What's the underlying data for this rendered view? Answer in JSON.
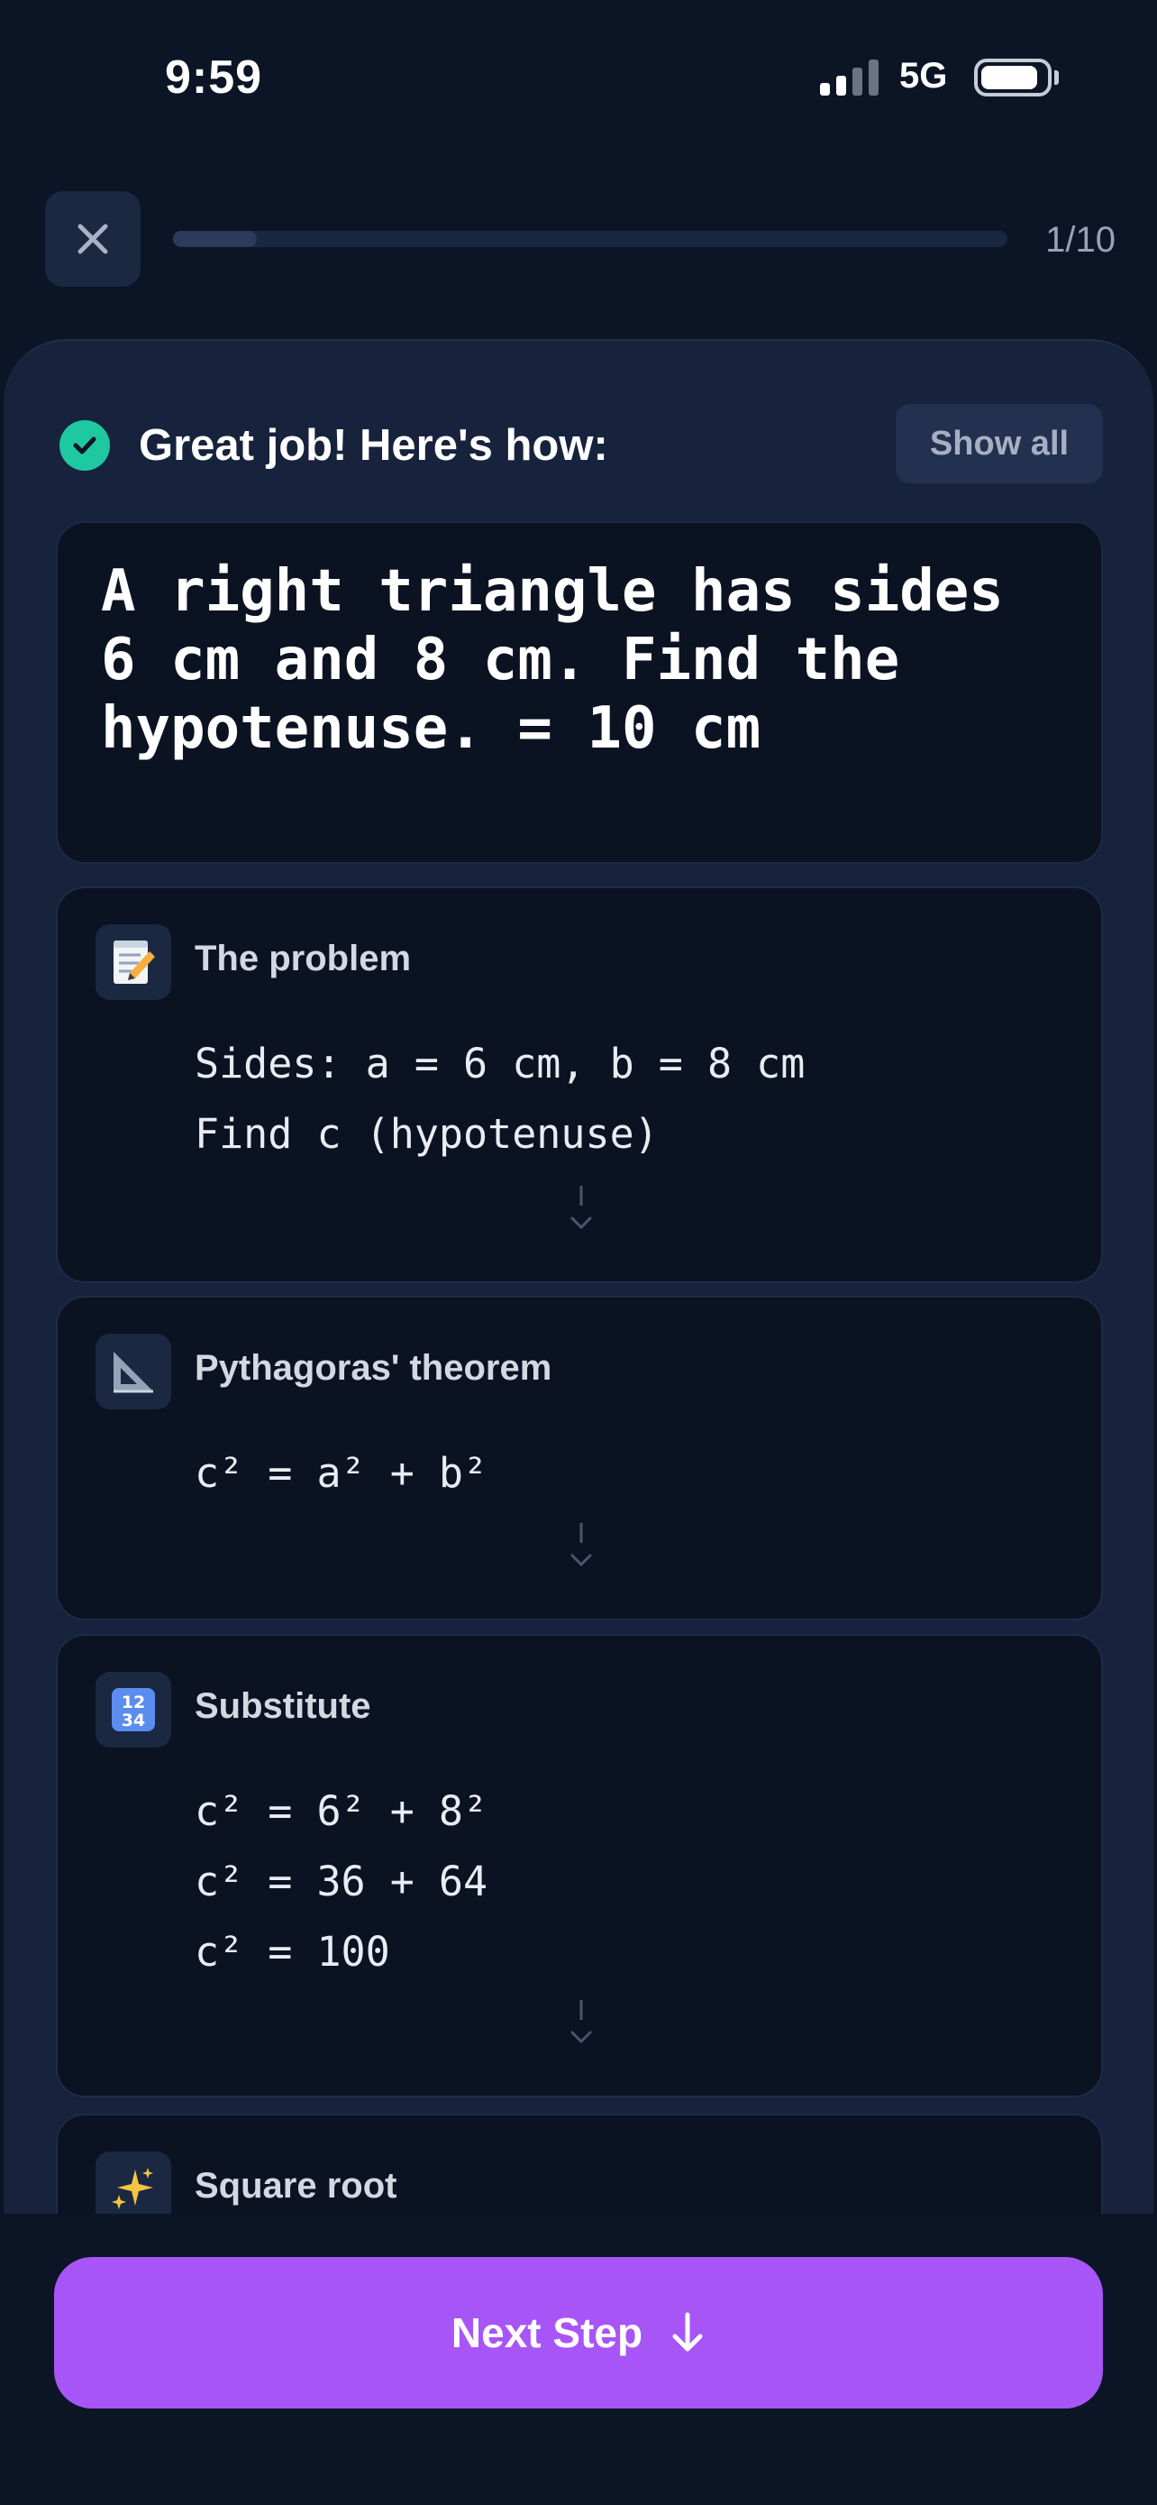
{
  "status_bar": {
    "time": "9:59",
    "network": "5G"
  },
  "header": {
    "progress_counter": "1/10",
    "progress_fraction": 0.1
  },
  "result": {
    "message": "Great job! Here's how:",
    "show_all_label": "Show all"
  },
  "answer": {
    "text": "A right triangle has sides 6 cm and 8 cm. Find the hypotenuse. = 10 cm"
  },
  "steps": [
    {
      "icon": "memo-icon",
      "title": "The problem",
      "lines": [
        "Sides: a = 6 cm, b = 8 cm",
        "Find c (hypotenuse)"
      ]
    },
    {
      "icon": "triangular-ruler-icon",
      "title": "Pythagoras' theorem",
      "lines": [
        "c² = a² + b²"
      ]
    },
    {
      "icon": "numbers-input-icon",
      "title": "Substitute",
      "lines": [
        "c² = 6² + 8²",
        "c² = 36 + 64",
        "c² = 100"
      ]
    },
    {
      "icon": "sparkles-icon",
      "title": "Square root",
      "lines": []
    }
  ],
  "footer": {
    "next_label": "Next Step"
  },
  "colors": {
    "accent": "#a855f7",
    "success": "#1ec8a0",
    "background": "#0c1526"
  }
}
